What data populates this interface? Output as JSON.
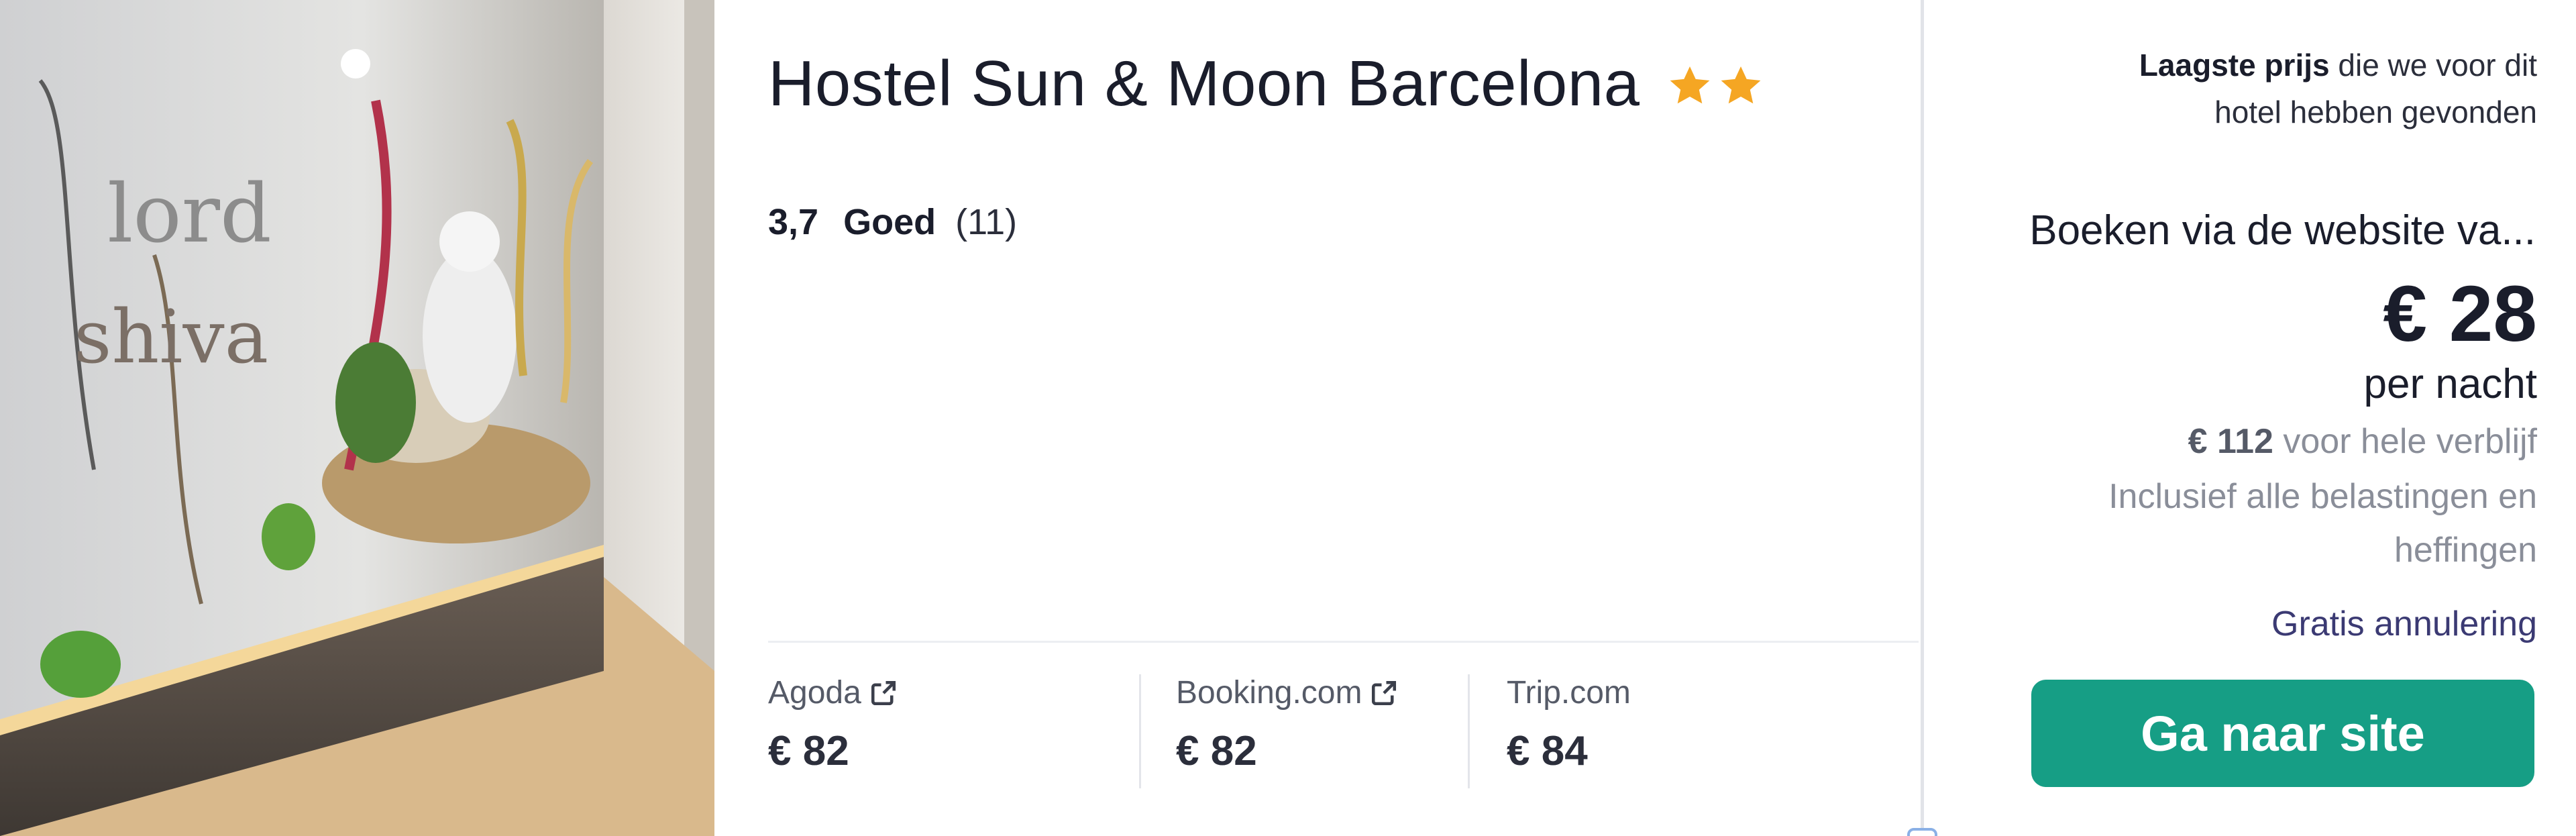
{
  "hotel": {
    "name": "Hostel Sun & Moon Barcelona",
    "star_count": 2,
    "star_icon": "star-icon",
    "star_color": "#f5a623"
  },
  "rating": {
    "score": "3,7",
    "label": "Goed",
    "count": "(11)"
  },
  "providers": [
    {
      "name": "Agoda",
      "price": "€ 82",
      "external_icon": "external-link-icon"
    },
    {
      "name": "Booking.com",
      "price": "€ 82",
      "external_icon": "external-link-icon"
    },
    {
      "name": "Trip.com",
      "price": "€ 84"
    }
  ],
  "price_panel": {
    "lowest_bold": "Laagste prijs",
    "lowest_rest_1": "die we voor dit",
    "lowest_rest_2": "hotel hebben gevonden",
    "book_via": "Boeken via de website va...",
    "price": "€ 28",
    "per_night": "per nacht",
    "total_amount": "€ 112",
    "total_suffix": "voor hele verblijf",
    "taxes_line1": "Inclusief alle belastingen en",
    "taxes_line2": "heffingen",
    "cancellation": "Gratis annulering",
    "cta_label": "Ga naar site",
    "cta_color": "#169e85"
  }
}
